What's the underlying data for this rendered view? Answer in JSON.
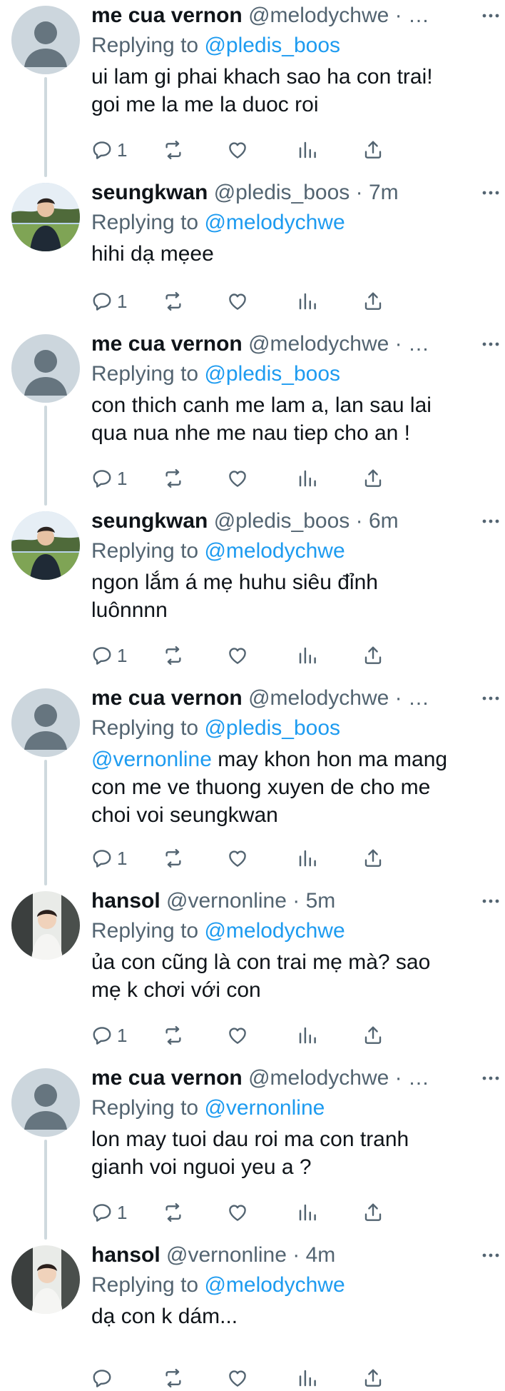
{
  "colors": {
    "text": "#0f1419",
    "muted": "#536471",
    "link": "#1d9bf0",
    "line": "#cfd9de"
  },
  "replying_label": "Replying to",
  "tweets": [
    {
      "name": "me cua vernon",
      "handle": "@melodychwe",
      "meta": "· …",
      "replying_to": "@pledis_boos",
      "lines": [
        [
          {
            "t": "ui lam gi phai khach sao ha con trai!"
          }
        ],
        [
          {
            "t": "goi me la me la duoc roi"
          }
        ]
      ],
      "reply_count": "1",
      "avatar": "default"
    },
    {
      "name": "seungkwan",
      "handle": "@pledis_boos",
      "meta": "· 7m",
      "replying_to": "@melodychwe",
      "lines": [
        [
          {
            "t": "hihi dạ mẹee"
          }
        ]
      ],
      "reply_count": "1",
      "avatar": "seungkwan"
    },
    {
      "name": "me cua vernon",
      "handle": "@melodychwe",
      "meta": "· …",
      "replying_to": "@pledis_boos",
      "lines": [
        [
          {
            "t": "con thich canh me lam a, lan sau lai"
          }
        ],
        [
          {
            "t": "qua nua nhe me nau tiep cho an !"
          }
        ]
      ],
      "reply_count": "1",
      "avatar": "default"
    },
    {
      "name": "seungkwan",
      "handle": "@pledis_boos",
      "meta": "· 6m",
      "replying_to": "@melodychwe",
      "lines": [
        [
          {
            "t": "ngon lắm á mẹ huhu siêu đỉnh"
          }
        ],
        [
          {
            "t": "luônnnn"
          }
        ]
      ],
      "reply_count": "1",
      "avatar": "seungkwan"
    },
    {
      "name": "me cua vernon",
      "handle": "@melodychwe",
      "meta": "· …",
      "replying_to": "@pledis_boos",
      "lines": [
        [
          {
            "t": "@vernonline",
            "mention": true
          },
          {
            "t": " may khon hon ma mang"
          }
        ],
        [
          {
            "t": "con me ve thuong xuyen de cho me"
          }
        ],
        [
          {
            "t": "choi voi seungkwan"
          }
        ]
      ],
      "reply_count": "1",
      "avatar": "default"
    },
    {
      "name": "hansol",
      "handle": "@vernonline",
      "meta": "· 5m",
      "replying_to": "@melodychwe",
      "lines": [
        [
          {
            "t": "ủa con cũng là con trai mẹ mà? sao"
          }
        ],
        [
          {
            "t": "mẹ k chơi với con"
          }
        ]
      ],
      "reply_count": "1",
      "avatar": "hansol"
    },
    {
      "name": "me cua vernon",
      "handle": "@melodychwe",
      "meta": "· …",
      "replying_to": "@vernonline",
      "lines": [
        [
          {
            "t": "lon may tuoi dau roi ma con tranh"
          }
        ],
        [
          {
            "t": "gianh voi nguoi yeu a ?"
          }
        ]
      ],
      "reply_count": "1",
      "avatar": "default"
    },
    {
      "name": "hansol",
      "handle": "@vernonline",
      "meta": "· 4m",
      "replying_to": "@melodychwe",
      "lines": [
        [
          {
            "t": "dạ con k dám..."
          }
        ]
      ],
      "reply_count": "",
      "avatar": "hansol"
    }
  ]
}
